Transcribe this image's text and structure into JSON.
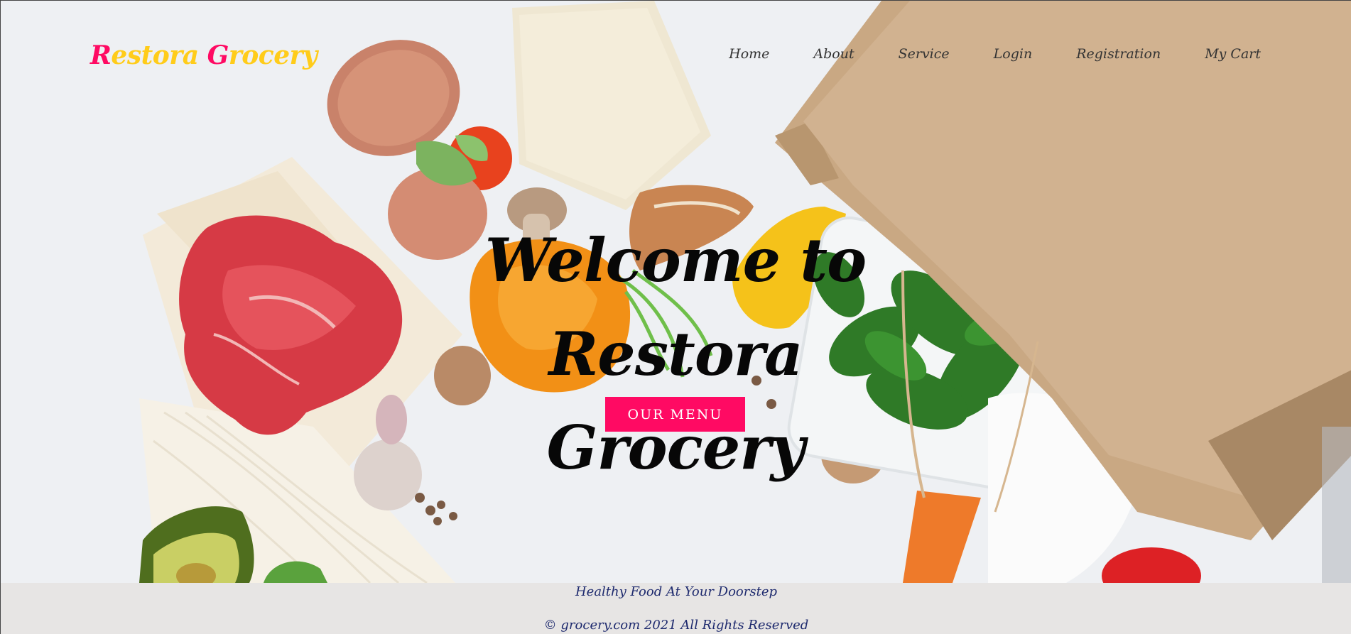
{
  "brand": {
    "part1_cap": "R",
    "part1_rest": "estora ",
    "part2_cap": "G",
    "part2_rest": "rocery",
    "cap_color": "#ff0a63",
    "rest_color": "#ffcc1a"
  },
  "nav": {
    "items": [
      {
        "label": "Home"
      },
      {
        "label": "About"
      },
      {
        "label": "Service"
      },
      {
        "label": "Login"
      },
      {
        "label": "Registration"
      },
      {
        "label": "My Cart"
      }
    ]
  },
  "hero": {
    "title_line1": "Welcome to Restora",
    "title_line2": "Grocery",
    "button_label": "OUR MENU",
    "button_color": "#ff0a63"
  },
  "footer": {
    "tagline": "Healthy Food At Your Doorstep",
    "copyright": "© grocery.com 2021 All Rights Reserved"
  }
}
